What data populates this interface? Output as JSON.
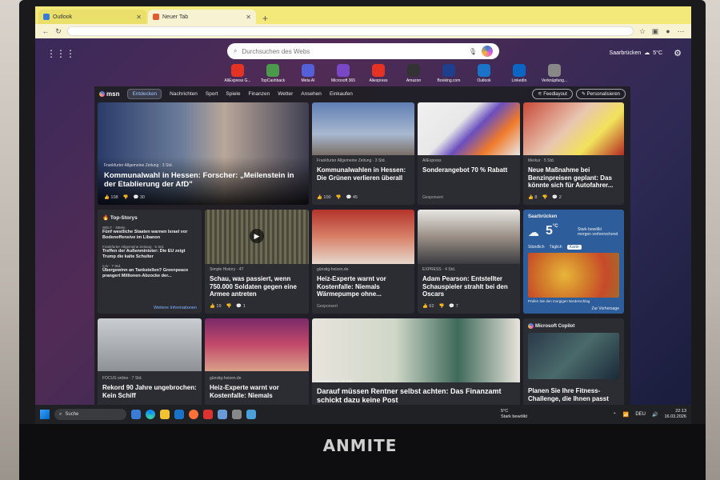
{
  "monitor_brand": "ANMITE",
  "browser": {
    "tabs": [
      {
        "label": "Outlook"
      },
      {
        "label": "Neuer Tab"
      }
    ],
    "new_tab_symbol": "+"
  },
  "ntp": {
    "search_placeholder": "Durchsuchen des Webs",
    "weather_top": "Saarbrücken",
    "weather_top_temp": "5°C",
    "quicklinks": [
      {
        "label": "AliExpress G...",
        "color": "#e43225"
      },
      {
        "label": "TopCashback",
        "color": "#4b9a4b"
      },
      {
        "label": "Meta AI",
        "color": "#5560d8"
      },
      {
        "label": "Microsoft 365",
        "color": "#7a47c7"
      },
      {
        "label": "Aliexpress",
        "color": "#e43225"
      },
      {
        "label": "Amazon",
        "color": "#333333"
      },
      {
        "label": "Booking.com",
        "color": "#1f3f8c"
      },
      {
        "label": "Outlook",
        "color": "#1a73c8"
      },
      {
        "label": "LinkedIn",
        "color": "#0a66c2"
      },
      {
        "label": "Verknüpfung...",
        "color": "#888888"
      }
    ]
  },
  "feed": {
    "brand": "msn",
    "nav": [
      "Entdecken",
      "Nachrichten",
      "Sport",
      "Spiele",
      "Finanzen",
      "Wetter",
      "Ansehen",
      "Einkaufen"
    ],
    "feedlayout": "Feedlayout",
    "personalize": "Personalisieren",
    "cards": {
      "hero": {
        "source": "Frankfurter Allgemeine Zeitung · 3 Std.",
        "title": "Kommunalwahl in Hessen: Forscher: „Meilenstein in der Etablierung der AfD\"",
        "likes": "108",
        "comments": "30"
      },
      "c2": {
        "source": "Frankfurter Allgemeine Zeitung · 3 Std.",
        "title": "Kommunalwahlen in Hessen: Die Grünen verlieren überall",
        "likes": "100",
        "comments": "45"
      },
      "c3": {
        "source": "AliExpress",
        "title": "Sonderangebot 70 % Rabatt",
        "sponsored": "Gesponsert"
      },
      "c4": {
        "source": "Merkur · 5 Std.",
        "title": "Neue Maßnahme bei Benzinpreisen geplant: Das könnte sich für Autofahrer...",
        "likes": "8",
        "comments": "2"
      },
      "topstories": {
        "header": "Top-Storys",
        "items": [
          {
            "source": "WELT · 38Min.",
            "title": "Fünf westliche Staaten warnen Israel vor Bodenoffensive im Libanon"
          },
          {
            "source": "Frankfurter Allgemeine Zeitung · 5 Std.",
            "title": "Treffen der Außenminister: Die EU zeigt Trump die kalte Schulter"
          },
          {
            "source": "n-tv · 7 Std.",
            "title": "Übergewinn an Tankstellen? Greenpeace prangert Millionen-Abzocke der..."
          }
        ],
        "more": "Weitere Informationen"
      },
      "c6": {
        "source": "Simple History · 4T",
        "title": "Schau, was passiert, wenn 750.000 Soldaten gegen eine Armee antreten",
        "likes": "19",
        "comments": "1"
      },
      "c7": {
        "source": "günstig-heizen.de",
        "title": "Heiz-Experte warnt vor Kostenfalle: Niemals Wärmepumpe ohne...",
        "sponsored": "Gesponsert"
      },
      "c8": {
        "source": "EXPRESS · 4 Std.",
        "title": "Adam Pearson: Entstellter Schauspieler strahlt bei den Oscars",
        "likes": "62",
        "comments": "7"
      },
      "weather": {
        "city": "Saarbrücken",
        "temp": "5",
        "unit": "°C",
        "desc": "Stark bewölkt",
        "forecast": "morgen vorherrschend",
        "tabs": [
          "Stündlich",
          "Täglich",
          "Karte"
        ],
        "footer": "Prüfen Sie den morgigen Niederschlag",
        "more": "Zur Vorhersage"
      },
      "c10": {
        "source": "FOCUS online · 7 Std.",
        "title": "Rekord 90 Jahre ungebrochen: Kein Schiff"
      },
      "c11": {
        "source": "günstig-heizen.de",
        "title": "Heiz-Experte warnt vor Kostenfalle: Niemals"
      },
      "c12": {
        "source": "infranken.de · 5 Std.",
        "title": "Darauf müssen Rentner selbst achten: Das Finanzamt schickt dazu keine Post"
      },
      "copilot": {
        "header": "Microsoft Copilot",
        "title": "Planen Sie Ihre Fitness-Challenge, die Ihnen passt"
      }
    }
  },
  "taskbar": {
    "search": "Suche",
    "weather_temp": "5°C",
    "weather_desc": "Stark bewölkt",
    "lang": "DEU",
    "time": "22:13",
    "date": "16.03.2026"
  }
}
